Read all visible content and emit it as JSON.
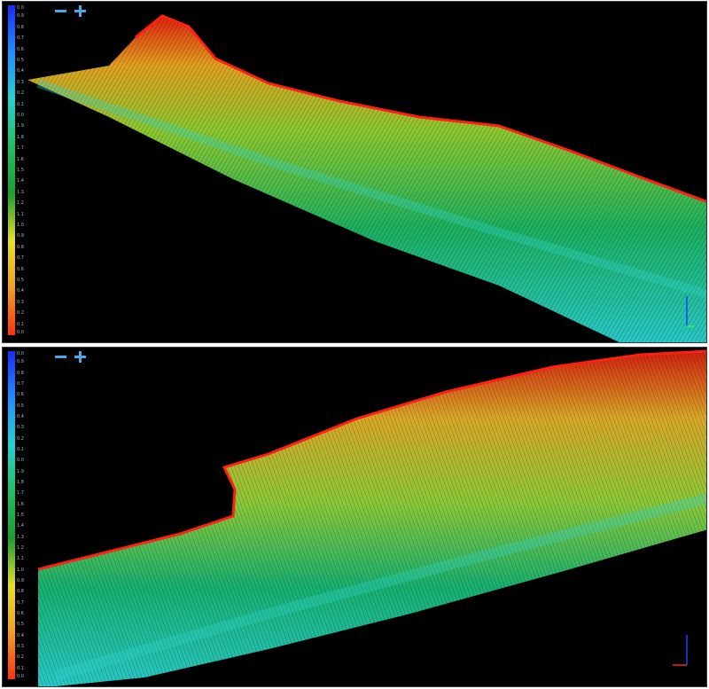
{
  "viewports": [
    {
      "id": "top",
      "controls": {
        "zoom_out": "zoom-out",
        "zoom_in": "zoom-in"
      },
      "scale_labels": [
        "0.0",
        "0.9",
        "0.8",
        "0.7",
        "0.6",
        "0.5",
        "0.4",
        "0.3",
        "0.2",
        "0.1",
        "0.0",
        "1.9",
        "1.8",
        "1.7",
        "1.6",
        "1.5",
        "1.4",
        "1.3",
        "1.2",
        "1.1",
        "1.0",
        "0.9",
        "0.8",
        "0.7",
        "0.6",
        "0.5",
        "0.4",
        "0.3",
        "0.2",
        "0.1",
        "0.0"
      ]
    },
    {
      "id": "bottom",
      "controls": {
        "zoom_out": "zoom-out",
        "zoom_in": "zoom-in"
      },
      "scale_labels": [
        "0.0",
        "0.9",
        "0.8",
        "0.7",
        "0.6",
        "0.5",
        "0.4",
        "0.3",
        "0.2",
        "0.1",
        "0.0",
        "1.9",
        "1.8",
        "1.7",
        "1.6",
        "1.5",
        "1.4",
        "1.3",
        "1.2",
        "1.1",
        "1.0",
        "0.9",
        "0.8",
        "0.7",
        "0.6",
        "0.5",
        "0.4",
        "0.3",
        "0.2",
        "0.1",
        "0.0"
      ]
    }
  ],
  "colors": {
    "background": "#000000",
    "scale_gradient": [
      "#1a2cff",
      "#1e90ff",
      "#22d3d3",
      "#20c060",
      "#18a030",
      "#e8e020",
      "#f0a020",
      "#ff3010"
    ],
    "zoom_icon": "#4aa8e8",
    "axis_x": "#ff2020",
    "axis_y": "#2040ff"
  }
}
